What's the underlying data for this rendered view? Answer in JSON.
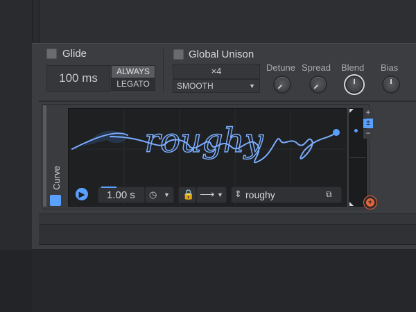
{
  "glide": {
    "label": "Glide",
    "time_value": "100 ms",
    "mode_always": "ALWAYS",
    "mode_legato": "LEGATO"
  },
  "unison": {
    "label": "Global Unison",
    "voices": "×4",
    "mode": "SMOOTH",
    "knobs": [
      {
        "label": "Detune"
      },
      {
        "label": "Spread"
      },
      {
        "label": "Blend"
      },
      {
        "label": "Bias"
      }
    ]
  },
  "curve": {
    "section_label": "Curve",
    "display_text": "roughy",
    "time_value": "1.00 s",
    "preset_name": "roughy",
    "zoom_plus": "+",
    "zoom_fit": "±",
    "zoom_minus": "−"
  },
  "colors": {
    "accent": "#5aa0ff",
    "curve_line": "#7aaeff",
    "add_button": "#e8653a"
  }
}
